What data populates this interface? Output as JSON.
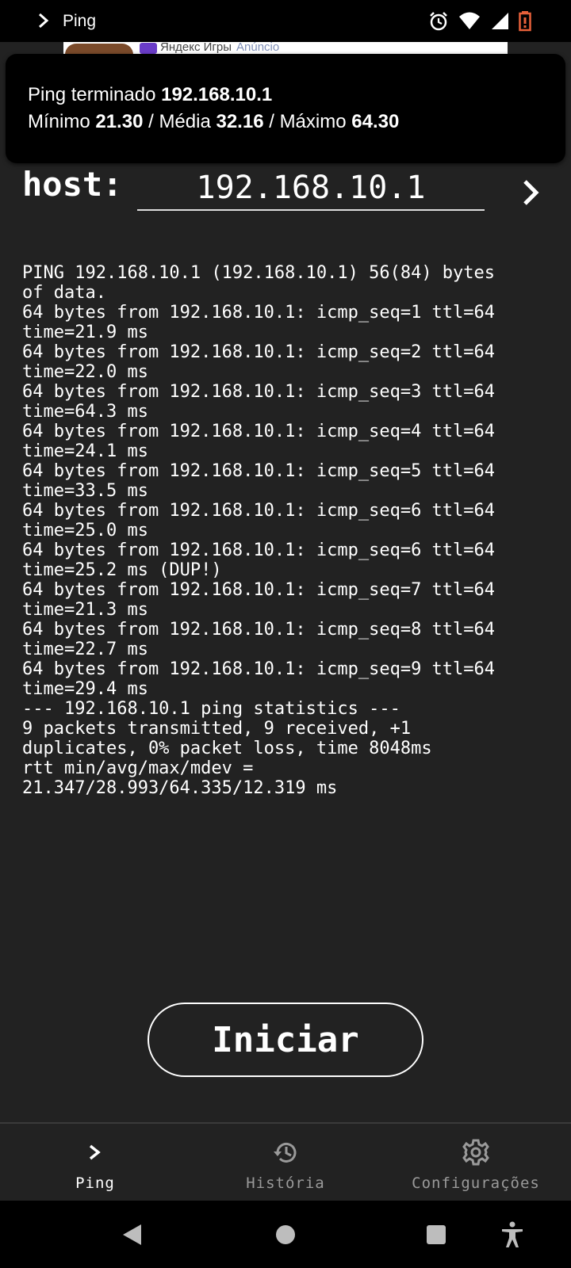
{
  "status_bar": {
    "app_title": "Ping",
    "icons": [
      "chevron-right-icon",
      "alarm-icon",
      "wifi-icon",
      "signal-icon",
      "battery-icon"
    ],
    "battery_color": "#e8613a"
  },
  "ad": {
    "brand": "Яндекс Игры",
    "tag": "Anúncio"
  },
  "toast": {
    "line1_prefix": "Ping terminado ",
    "line1_host": "192.168.10.1",
    "min_label": "Mínimo ",
    "min_value": "21.30",
    "sep1": " / ",
    "avg_label": "Média ",
    "avg_value": "32.16",
    "sep2": " / ",
    "max_label": "Máximo ",
    "max_value": "64.30"
  },
  "host": {
    "label": "host:",
    "value": "192.168.10.1"
  },
  "output": {
    "lines": [
      "PING 192.168.10.1 (192.168.10.1) 56(84) bytes",
      "of data.",
      "64 bytes from 192.168.10.1: icmp_seq=1 ttl=64",
      "time=21.9 ms",
      "64 bytes from 192.168.10.1: icmp_seq=2 ttl=64",
      "time=22.0 ms",
      "64 bytes from 192.168.10.1: icmp_seq=3 ttl=64",
      "time=64.3 ms",
      "64 bytes from 192.168.10.1: icmp_seq=4 ttl=64",
      "time=24.1 ms",
      "64 bytes from 192.168.10.1: icmp_seq=5 ttl=64",
      "time=33.5 ms",
      "64 bytes from 192.168.10.1: icmp_seq=6 ttl=64",
      "time=25.0 ms",
      "64 bytes from 192.168.10.1: icmp_seq=6 ttl=64",
      "time=25.2 ms (DUP!)",
      "64 bytes from 192.168.10.1: icmp_seq=7 ttl=64",
      "time=21.3 ms",
      "64 bytes from 192.168.10.1: icmp_seq=8 ttl=64",
      "time=22.7 ms",
      "64 bytes from 192.168.10.1: icmp_seq=9 ttl=64",
      "time=29.4 ms",
      "--- 192.168.10.1 ping statistics ---",
      "9 packets transmitted, 9 received, +1",
      "duplicates, 0% packet loss, time 8048ms",
      "rtt min/avg/max/mdev =",
      "21.347/28.993/64.335/12.319 ms"
    ]
  },
  "start_button": {
    "label": "Iniciar"
  },
  "bottom_nav": {
    "items": [
      {
        "label": "Ping",
        "icon": "chevron-right-icon",
        "active": true
      },
      {
        "label": "História",
        "icon": "history-icon",
        "active": false
      },
      {
        "label": "Configurações",
        "icon": "gear-icon",
        "active": false
      }
    ]
  },
  "system_nav": {
    "icons": [
      "back-icon",
      "home-icon",
      "recents-icon",
      "accessibility-icon"
    ]
  }
}
